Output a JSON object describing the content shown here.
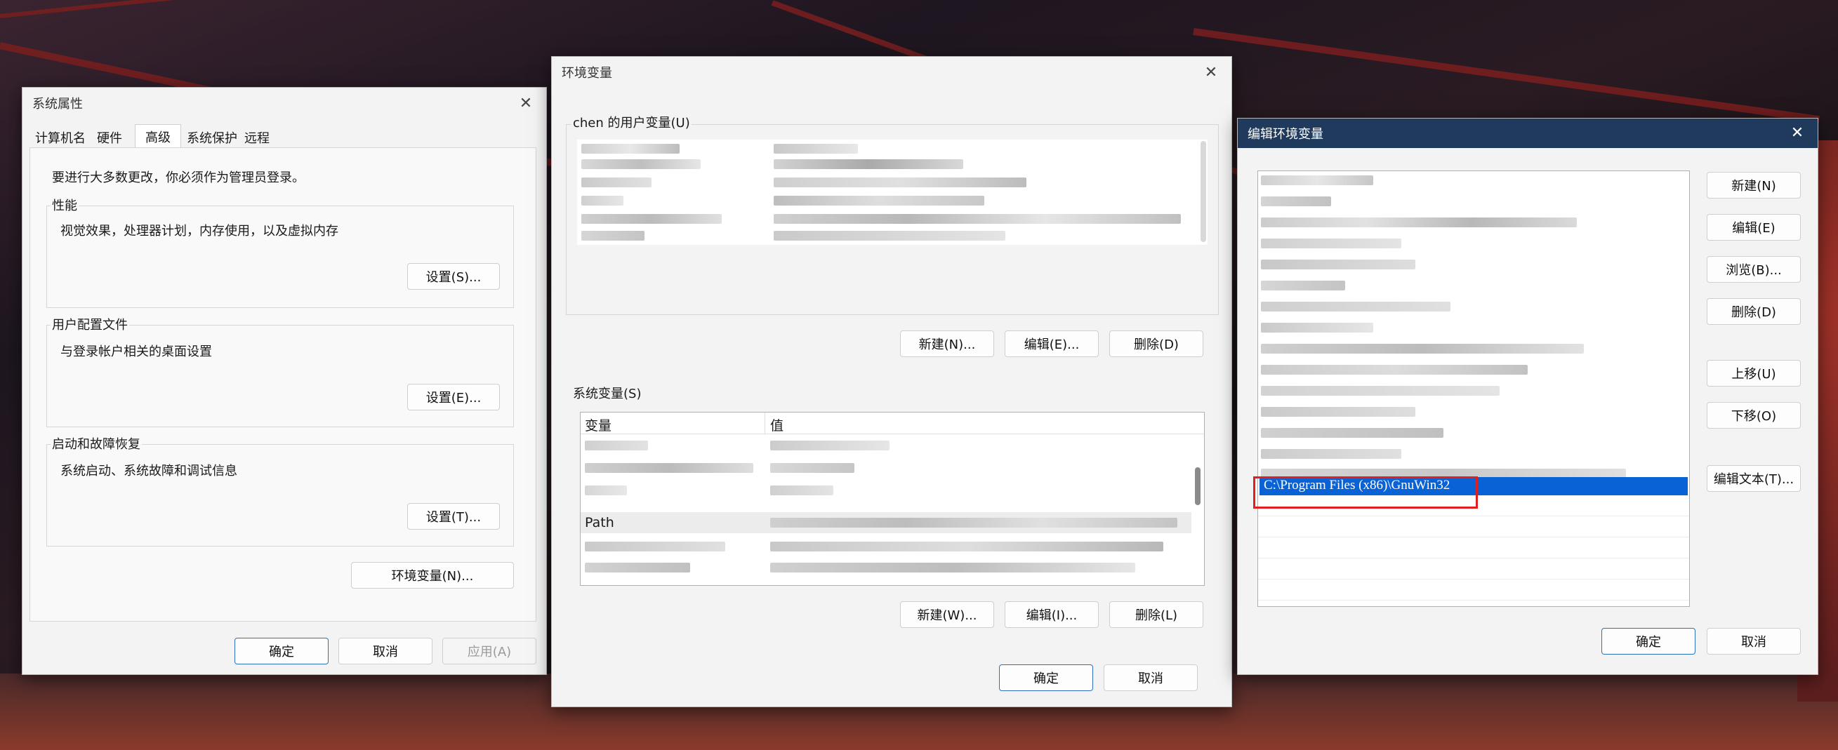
{
  "sys_props": {
    "title": "系统属性",
    "tabs": [
      "计算机名",
      "硬件",
      "高级",
      "系统保护",
      "远程"
    ],
    "admin_note": "要进行大多数更改，你必须作为管理员登录。",
    "perf": {
      "label": "性能",
      "desc": "视觉效果，处理器计划，内存使用，以及虚拟内存",
      "button": "设置(S)..."
    },
    "profile": {
      "label": "用户配置文件",
      "desc": "与登录帐户相关的桌面设置",
      "button": "设置(E)..."
    },
    "startup": {
      "label": "启动和故障恢复",
      "desc": "系统启动、系统故障和调试信息",
      "button": "设置(T)..."
    },
    "env_button": "环境变量(N)...",
    "ok": "确定",
    "cancel": "取消",
    "apply": "应用(A)"
  },
  "env_vars": {
    "title": "环境变量",
    "user_label": "chen 的用户变量(U)",
    "user_new": "新建(N)...",
    "user_edit": "编辑(E)...",
    "user_delete": "删除(D)",
    "sys_label": "系统变量(S)",
    "col_var": "变量",
    "col_val": "值",
    "path_var": "Path",
    "sys_new": "新建(W)...",
    "sys_edit": "编辑(I)...",
    "sys_delete": "删除(L)",
    "ok": "确定",
    "cancel": "取消"
  },
  "edit_env": {
    "title": "编辑环境变量",
    "selected_entry": "C:\\Program Files (x86)\\GnuWin32",
    "new": "新建(N)",
    "edit": "编辑(E)",
    "browse": "浏览(B)...",
    "delete": "删除(D)",
    "move_up": "上移(U)",
    "move_down": "下移(O)",
    "edit_text": "编辑文本(T)...",
    "ok": "确定",
    "cancel": "取消",
    "accent_color": "#0a63d6",
    "highlight_box_color": "#e02020"
  },
  "icons": {
    "close": "✕"
  }
}
